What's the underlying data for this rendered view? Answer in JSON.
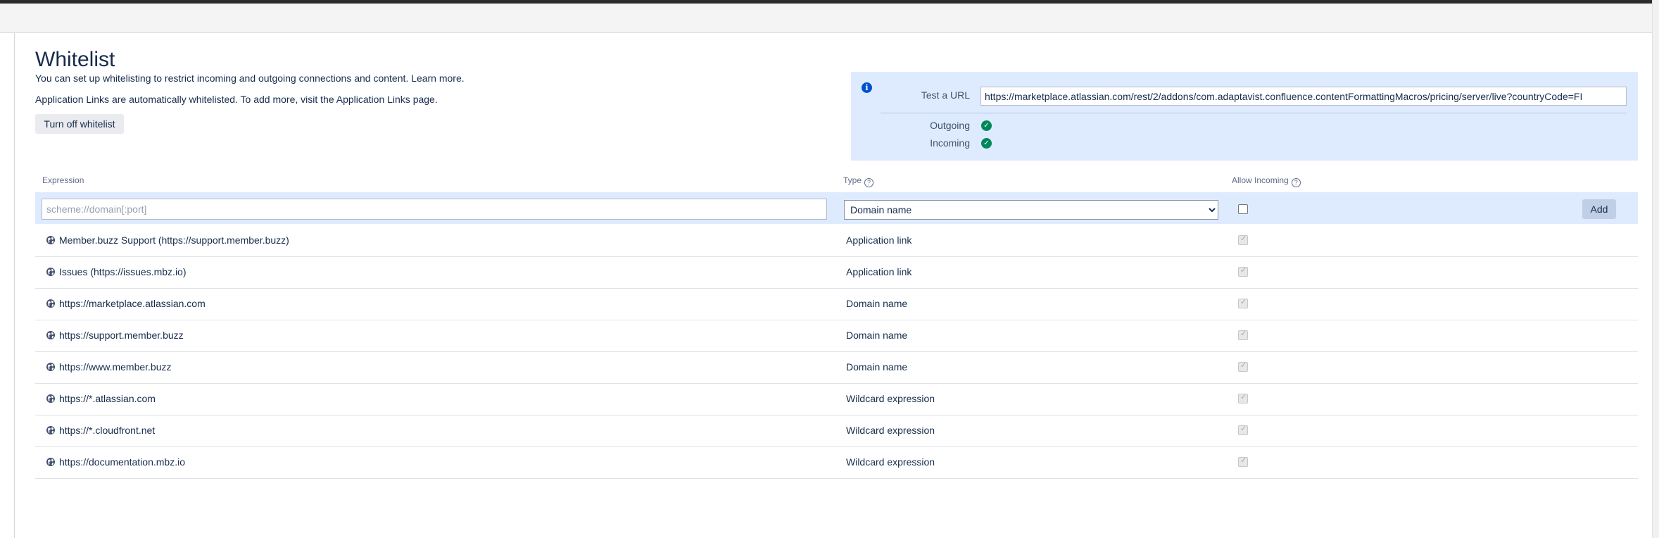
{
  "page": {
    "title": "Whitelist",
    "desc1_text": "You can set up whitelisting to restrict incoming and outgoing connections and content.",
    "desc1_link": "Learn more.",
    "desc2_prefix": "Application Links are automatically whitelisted. To add more, visit the",
    "desc2_link": "Application Links",
    "desc2_suffix": "page.",
    "turn_off_label": "Turn off whitelist"
  },
  "test_panel": {
    "label": "Test a URL",
    "url": "https://marketplace.atlassian.com/rest/2/addons/com.adaptavist.confluence.contentFormattingMacros/pricing/server/live?countryCode=FI",
    "outgoing_label": "Outgoing",
    "incoming_label": "Incoming"
  },
  "table": {
    "headers": {
      "expression": "Expression",
      "type": "Type",
      "allow_incoming": "Allow Incoming"
    },
    "new_row": {
      "placeholder": "scheme://domain[:port]",
      "type_selected": "Domain name",
      "add_label": "Add"
    },
    "rows": [
      {
        "expression": "Member.buzz Support (https://support.member.buzz)",
        "type": "Application link"
      },
      {
        "expression": "Issues (https://issues.mbz.io)",
        "type": "Application link"
      },
      {
        "expression": "https://marketplace.atlassian.com",
        "type": "Domain name"
      },
      {
        "expression": "https://support.member.buzz",
        "type": "Domain name"
      },
      {
        "expression": "https://www.member.buzz",
        "type": "Domain name"
      },
      {
        "expression": "https://*.atlassian.com",
        "type": "Wildcard expression"
      },
      {
        "expression": "https://*.cloudfront.net",
        "type": "Wildcard expression"
      },
      {
        "expression": "https://documentation.mbz.io",
        "type": "Wildcard expression"
      }
    ]
  },
  "icons": {
    "info": "info-icon",
    "status_ok": "check-circle-icon",
    "row": "globe-icon",
    "help": "question-circle-icon"
  },
  "colors": {
    "panel_bg": "#deebff",
    "ok_green": "#00875a",
    "info_blue": "#0052cc",
    "text": "#172b4d"
  }
}
